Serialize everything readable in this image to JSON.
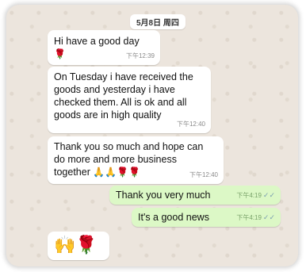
{
  "chat": {
    "date": "5月8日 周四",
    "messages": [
      {
        "direction": "incoming",
        "text": "Hi have a good day",
        "emoji": "🌹",
        "time": "下午12:39"
      },
      {
        "direction": "incoming",
        "lines": [
          "On Tuesday i have received the",
          "goods and yesterday i have",
          "checked them. All is ok and all",
          "goods are in high quality"
        ],
        "time": "下午12:40"
      },
      {
        "direction": "incoming",
        "lines": [
          "Thank you so much and hope can",
          "do more and more business",
          "together"
        ],
        "emoji": "🙏🙏🌹🌹",
        "time": "下午12:40"
      },
      {
        "direction": "outgoing",
        "text": "Thank you very much",
        "time": "下午4:19",
        "status": "read"
      },
      {
        "direction": "outgoing",
        "text": "It's a good news",
        "time": "下午4:19",
        "status": "read"
      },
      {
        "direction": "incoming",
        "emoji": "🙌🌹"
      }
    ]
  },
  "colors": {
    "background": "#ece5dd",
    "incoming_bubble": "#ffffff",
    "outgoing_bubble": "#dcf8c6",
    "timestamp": "#8a8a8a",
    "read_ticks": "#7a9eb0"
  },
  "icons": {
    "read_receipt": "double-check-icon",
    "rose": "rose-emoji",
    "pray": "folded-hands-emoji",
    "raised_hands": "raising-hands-emoji"
  }
}
